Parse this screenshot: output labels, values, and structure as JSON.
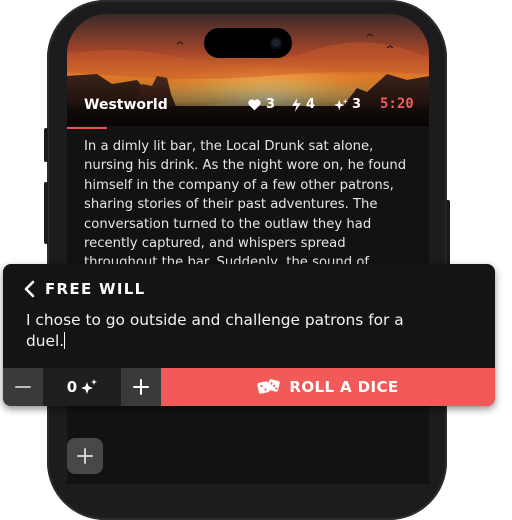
{
  "header": {
    "title": "Westworld",
    "stats": [
      {
        "icon": "heart-icon",
        "value": "3"
      },
      {
        "icon": "lightning-icon",
        "value": "4"
      },
      {
        "icon": "sparkle-icon",
        "value": "3"
      }
    ],
    "timer": "5:20"
  },
  "story": {
    "text": "In a dimly lit bar, the Local Drunk sat alone, nursing his drink. As the night wore on, he found himself in the company of a few other patrons, sharing stories of their past adventures. The conversation turned to the outlaw they had recently captured, and whispers spread throughout the bar. Suddenly, the sound of"
  },
  "free_will": {
    "title": "FREE WILL",
    "input_value": "I chose to go outside and challenge patrons for a duel.",
    "stepper_value": "0",
    "roll_label": "ROLL A DICE"
  },
  "colors": {
    "accent": "#f25a5a",
    "timer": "#f25b5b",
    "panel_bg": "#141414"
  }
}
